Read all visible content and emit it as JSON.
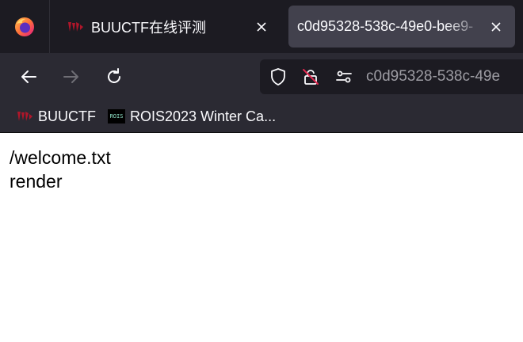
{
  "tabs": [
    {
      "title": "BUUCTF在线评测",
      "favicon": "buuctf-logo-icon",
      "active": false
    },
    {
      "title": "c0d95328-538c-49e0-bee9-",
      "favicon": "none",
      "active": true
    }
  ],
  "urlbar": {
    "text": "c0d95328-538c-49e"
  },
  "bookmarks": [
    {
      "label": "BUUCTF",
      "icon": "buuctf-logo-icon"
    },
    {
      "label": "ROIS2023 Winter Ca...",
      "icon": "rois-logo-icon",
      "icon_text": "ROIS"
    }
  ],
  "page": {
    "lines": [
      "/welcome.txt",
      "render"
    ]
  },
  "colors": {
    "tabbar_bg": "#1c1b22",
    "toolbar_bg": "#2b2a33",
    "active_tab_bg": "#42414d",
    "buuctf_red": "#b0162a"
  }
}
